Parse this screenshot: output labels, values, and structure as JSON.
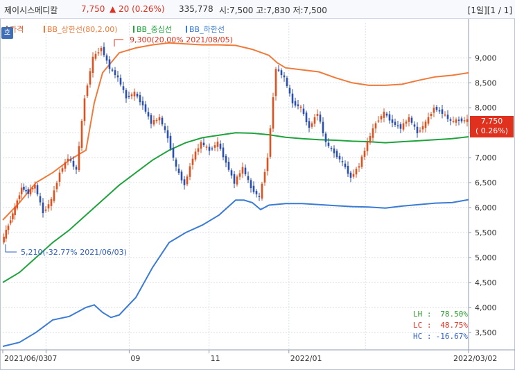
{
  "header": {
    "stock_name": "제이시스메디칼",
    "price": "7,750",
    "change": "▲ 20 (0.26%)",
    "volume": "335,778",
    "ohlc": "시:7,500  고:7,830  저:7,500",
    "pager": "[1일][1 / 1]"
  },
  "toolbar": {
    "tool_icon": "호"
  },
  "legend": [
    {
      "label": "가격",
      "color": "#e2501e"
    },
    {
      "label": "BB_상한선(80,2.00)",
      "color": "#f07a3a"
    },
    {
      "label": "BB_중심선",
      "color": "#1fa33c"
    },
    {
      "label": "BB_하한선",
      "color": "#3a7bd5"
    }
  ],
  "annotations": {
    "high": "9,300(20.00% 2021/08/05)",
    "low": "5,210(-32.77% 2021/06/03)"
  },
  "current_price_box": {
    "price": "7,750",
    "change": "( 0.26%)"
  },
  "stats": [
    {
      "label": "LH :",
      "value": "78.50%",
      "color": "#2f9a2f"
    },
    {
      "label": "LC :",
      "value": "48.75%",
      "color": "#e0301e"
    },
    {
      "label": "HC :",
      "value": "-16.67%",
      "color": "#2f5fc0"
    }
  ],
  "chart_data": {
    "type": "line",
    "x_labels": [
      "2021/06/03",
      "07",
      "09",
      "11",
      "2022/01",
      "2022/03/02"
    ],
    "y_ticks": [
      3500,
      4000,
      4500,
      5000,
      5500,
      6000,
      6500,
      7000,
      7500,
      8000,
      8500,
      9000
    ],
    "y_tick_labels": [
      "3,500",
      "4,000",
      "4,500",
      "5,000",
      "5,500",
      "6,000",
      "6,500",
      "7,000",
      "7,500",
      "8,000",
      "8,500",
      "9,000"
    ],
    "ylim": [
      3150,
      9700
    ],
    "series": [
      {
        "name": "가격",
        "color": "#e2501e",
        "x": [
          0,
          4,
          8,
          12,
          16,
          20,
          25,
          30,
          35,
          40,
          45,
          50,
          55,
          60,
          65,
          70,
          75,
          80,
          85,
          90,
          95,
          100,
          105,
          110,
          115,
          120,
          125,
          130,
          135,
          140,
          145,
          150,
          155,
          160,
          165,
          170,
          175,
          180,
          185,
          190,
          195,
          200,
          205,
          210,
          215,
          220,
          225,
          230,
          235,
          240,
          245,
          250,
          255,
          260,
          265,
          270,
          275,
          280
        ],
        "values": [
          5300,
          5650,
          6000,
          6400,
          6300,
          6450,
          5900,
          6150,
          6700,
          7000,
          6750,
          8200,
          9000,
          9200,
          8800,
          8600,
          8200,
          8300,
          8050,
          7700,
          7800,
          7400,
          6800,
          6450,
          7000,
          7300,
          7150,
          7300,
          6900,
          6500,
          6800,
          6400,
          6200,
          7000,
          8800,
          8600,
          8100,
          8000,
          7600,
          7900,
          7300,
          7100,
          6900,
          6600,
          6850,
          7300,
          7700,
          7900,
          7700,
          7600,
          7800,
          7500,
          7700,
          8000,
          7900,
          7730,
          7750,
          7750
        ]
      },
      {
        "name": "BB_상한선(80,2.00)",
        "color": "#f07a3a",
        "x": [
          0,
          10,
          20,
          30,
          40,
          50,
          55,
          60,
          70,
          80,
          90,
          100,
          110,
          120,
          130,
          140,
          150,
          160,
          165,
          170,
          180,
          190,
          200,
          210,
          220,
          230,
          240,
          250,
          260,
          270,
          280
        ],
        "values": [
          5750,
          6100,
          6500,
          6700,
          6950,
          7150,
          8100,
          8700,
          9100,
          9200,
          9260,
          9300,
          9280,
          9260,
          9260,
          9250,
          9170,
          9050,
          8900,
          8800,
          8760,
          8720,
          8600,
          8500,
          8450,
          8450,
          8470,
          8550,
          8620,
          8650,
          8700
        ]
      },
      {
        "name": "BB_중심선",
        "color": "#1fa33c",
        "x": [
          0,
          10,
          20,
          30,
          40,
          50,
          60,
          70,
          80,
          90,
          100,
          110,
          120,
          130,
          140,
          150,
          160,
          170,
          180,
          190,
          200,
          210,
          220,
          230,
          240,
          250,
          260,
          270,
          280
        ],
        "values": [
          4500,
          4700,
          5000,
          5300,
          5550,
          5850,
          6150,
          6450,
          6700,
          6950,
          7150,
          7300,
          7400,
          7450,
          7500,
          7490,
          7460,
          7410,
          7380,
          7360,
          7350,
          7330,
          7320,
          7300,
          7320,
          7340,
          7360,
          7380,
          7420
        ]
      },
      {
        "name": "BB_하한선",
        "color": "#3a7bd5",
        "x": [
          0,
          10,
          20,
          30,
          40,
          50,
          55,
          60,
          65,
          70,
          80,
          90,
          100,
          110,
          120,
          130,
          140,
          145,
          150,
          155,
          160,
          170,
          180,
          190,
          200,
          210,
          220,
          230,
          240,
          250,
          260,
          270,
          280
        ],
        "values": [
          3220,
          3300,
          3500,
          3750,
          3820,
          4000,
          4050,
          3900,
          3800,
          3850,
          4200,
          4800,
          5300,
          5500,
          5650,
          5850,
          6150,
          6150,
          6100,
          5960,
          6050,
          6080,
          6080,
          6060,
          6040,
          6020,
          6010,
          5990,
          6030,
          6060,
          6090,
          6100,
          6160
        ]
      }
    ]
  }
}
